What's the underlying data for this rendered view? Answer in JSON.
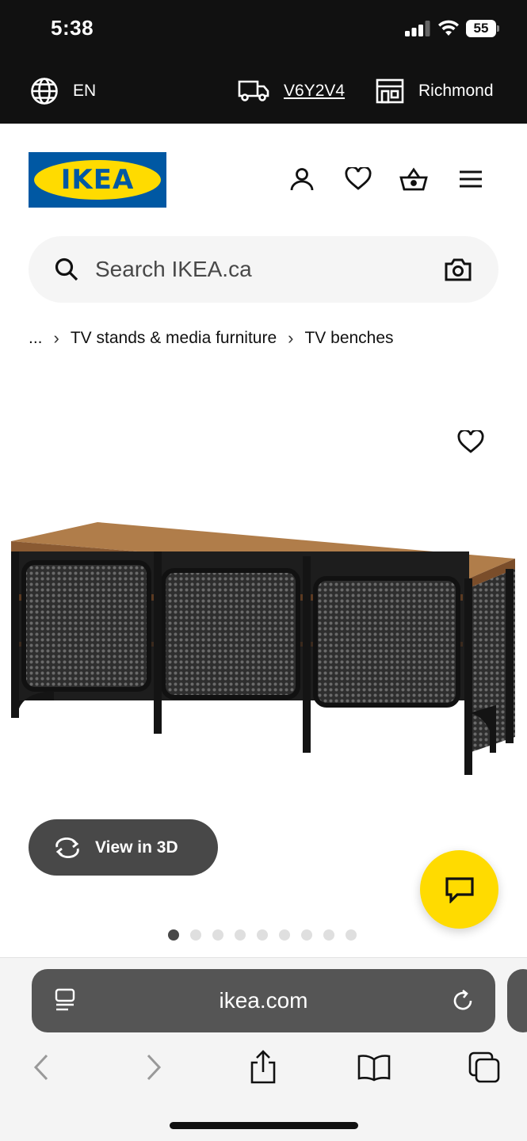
{
  "status_bar": {
    "time": "5:38",
    "battery": "55"
  },
  "info_bar": {
    "language": "EN",
    "postal_code": "V6Y2V4",
    "store": "Richmond"
  },
  "header": {
    "logo_text": "IKEA",
    "icons": [
      "user-icon",
      "heart-icon",
      "basket-icon",
      "menu-icon"
    ]
  },
  "search": {
    "placeholder": "Search IKEA.ca"
  },
  "breadcrumb": {
    "items": [
      "...",
      "TV stands & media furniture",
      "TV benches"
    ],
    "separator": "›"
  },
  "product": {
    "view_3d_label": "View in 3D",
    "gallery_total": 9,
    "gallery_active_index": 0
  },
  "browser": {
    "url": "ikea.com"
  },
  "colors": {
    "brand_blue": "#0058a3",
    "brand_yellow": "#ffdb00",
    "dark": "#111111",
    "button_gray": "#484848"
  }
}
